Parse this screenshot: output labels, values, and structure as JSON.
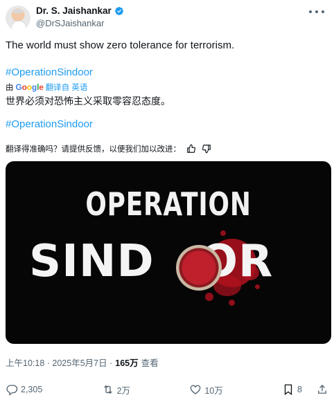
{
  "author": {
    "name": "Dr. S. Jaishankar",
    "handle": "@DrSJaishankar",
    "verified_color": "#1d9bf0"
  },
  "tweet": {
    "text": "The world must show zero tolerance for terrorism.",
    "hashtag_1": "#OperationSindoor",
    "translation": {
      "by_label": "由",
      "google_g1": "G",
      "google_o1": "o",
      "google_o2": "o",
      "google_g2": "g",
      "google_l": "l",
      "google_e": "e",
      "translate_link": "翻译自 英语",
      "translated_text": "世界必须对恐怖主义采取零容忍态度。"
    },
    "hashtag_2": "#OperationSindoor",
    "feedback_prompt": "翻译得准确吗？请提供反馈，以便我们加以改进："
  },
  "media": {
    "line1": "OPERATION",
    "line2_left": "SIND",
    "line2_right": "OR"
  },
  "meta": {
    "time": "上午10:18 · 2025年5月7日 ·",
    "views_count": "165万",
    "views_label": "查看"
  },
  "actions": {
    "replies": "2,305",
    "reposts": "2万",
    "likes": "10万",
    "bookmarks": "8"
  },
  "colors": {
    "link": "#1d9bf0",
    "muted": "#536471",
    "text": "#0f1419"
  }
}
